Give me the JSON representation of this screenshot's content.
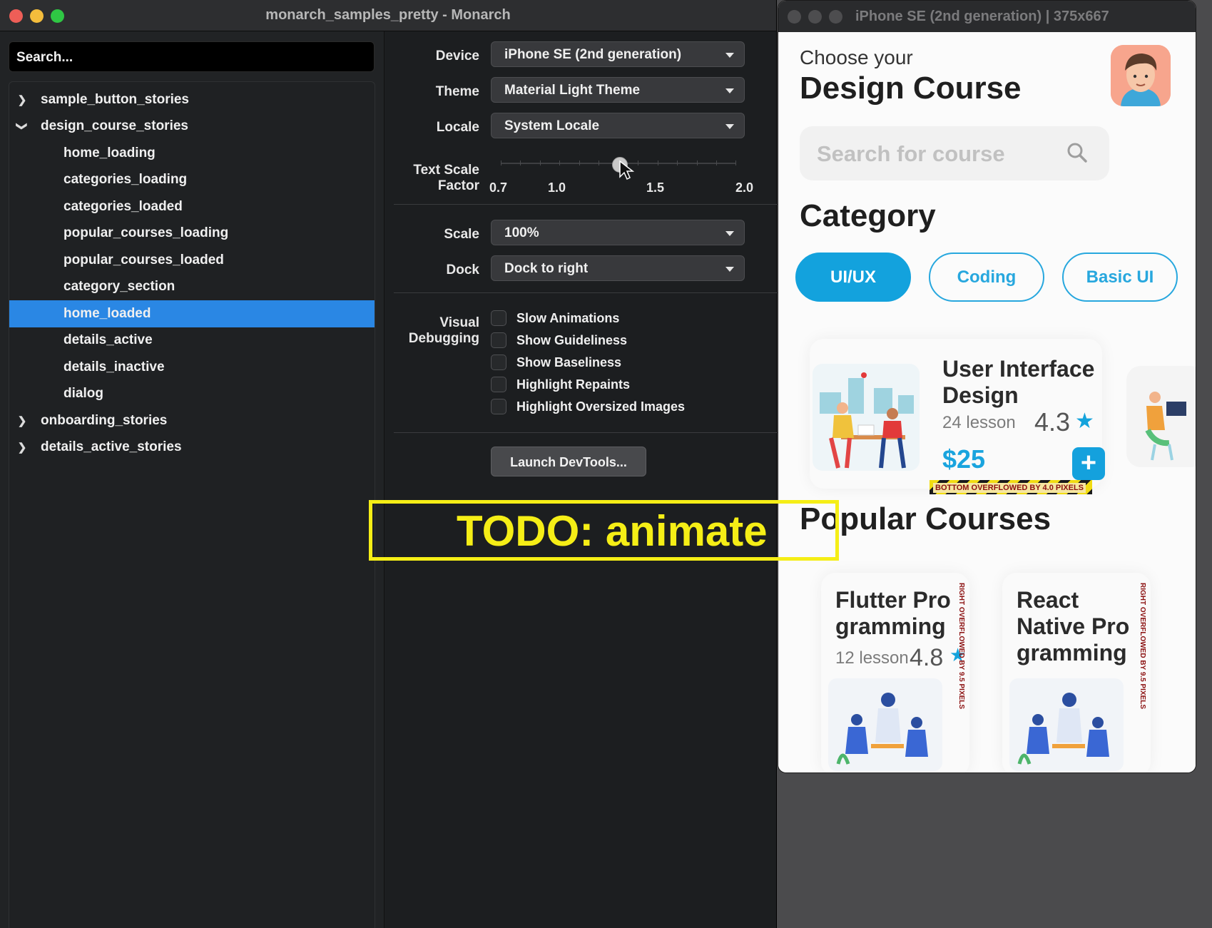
{
  "window": {
    "title": "monarch_samples_pretty - Monarch"
  },
  "sidebar": {
    "search_placeholder": "Search...",
    "items": [
      {
        "label": "sample_button_stories",
        "type": "group",
        "expanded": false
      },
      {
        "label": "design_course_stories",
        "type": "group",
        "expanded": true
      },
      {
        "label": "home_loading",
        "type": "story"
      },
      {
        "label": "categories_loading",
        "type": "story"
      },
      {
        "label": "categories_loaded",
        "type": "story"
      },
      {
        "label": "popular_courses_loading",
        "type": "story"
      },
      {
        "label": "popular_courses_loaded",
        "type": "story"
      },
      {
        "label": "category_section",
        "type": "story"
      },
      {
        "label": "home_loaded",
        "type": "story",
        "selected": true
      },
      {
        "label": "details_active",
        "type": "story"
      },
      {
        "label": "details_inactive",
        "type": "story"
      },
      {
        "label": "dialog",
        "type": "story"
      },
      {
        "label": "onboarding_stories",
        "type": "group",
        "expanded": false
      },
      {
        "label": "details_active_stories",
        "type": "group",
        "expanded": false
      }
    ]
  },
  "settings": {
    "device_label": "Device",
    "device_value": "iPhone SE (2nd generation)",
    "theme_label": "Theme",
    "theme_value": "Material Light Theme",
    "locale_label": "Locale",
    "locale_value": "System Locale",
    "text_scale_label_1": "Text Scale",
    "text_scale_label_2": "Factor",
    "text_scale_ticks": [
      "0.7",
      "1.0",
      "1.5",
      "2.0"
    ],
    "text_scale_value": 1.3,
    "scale_label": "Scale",
    "scale_value": "100%",
    "dock_label": "Dock",
    "dock_value": "Dock to right",
    "visual_debugging_label_1": "Visual",
    "visual_debugging_label_2": "Debugging",
    "checkboxes": [
      {
        "label": "Slow Animations",
        "checked": false
      },
      {
        "label": "Show Guideliness",
        "checked": false
      },
      {
        "label": "Show Baseliness",
        "checked": false
      },
      {
        "label": "Highlight Repaints",
        "checked": false
      },
      {
        "label": "Highlight Oversized Images",
        "checked": false
      }
    ],
    "devtools_button": "Launch DevTools..."
  },
  "annotation": {
    "text": "TODO: animate",
    "color": "#f5ee16"
  },
  "simulator": {
    "title": "iPhone SE (2nd generation) | 375x667",
    "app": {
      "greeting": "Choose your",
      "heading": "Design Course",
      "search_placeholder": "Search for course",
      "category_title": "Category",
      "chips": [
        "UI/UX",
        "Coding",
        "Basic UI"
      ],
      "featured_course": {
        "title": "User Interface Design",
        "lessons": "24 lesson",
        "rating": "4.3",
        "price": "$25",
        "overflow_warning": "BOTTOM OVERFLOWED BY 4.0 PIXELS"
      },
      "popular_title": "Popular Courses",
      "popular_courses": [
        {
          "title_line_1": "Flutter Pro",
          "title_line_2": "gramming",
          "lessons": "12 lesson",
          "rating": "4.8",
          "overflow_warning": "RIGHT OVERFLOWED BY 9.5 PIXELS"
        },
        {
          "title_line_1": "React",
          "title_line_2": "Native Pro",
          "title_line_3": "gramming",
          "overflow_warning": "RIGHT OVERFLOWED BY 9.5 PIXELS"
        }
      ]
    },
    "accent_color": "#14a3dc"
  }
}
